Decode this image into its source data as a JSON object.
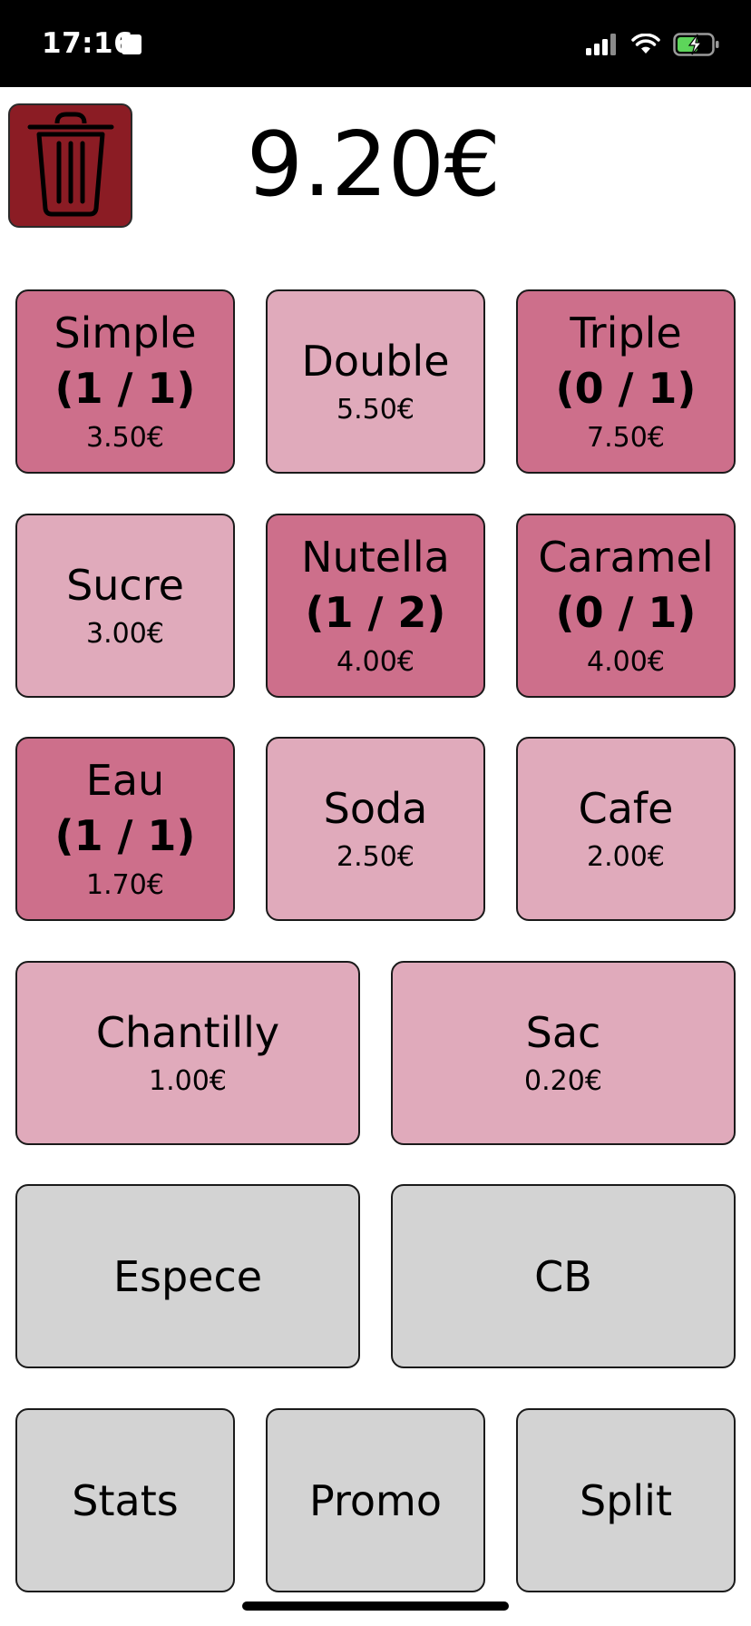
{
  "status_bar": {
    "time": "17:16"
  },
  "header": {
    "total": "9.20€",
    "trash_icon": "trash-icon",
    "trash_color": "#8b1c24"
  },
  "colors": {
    "tile_light": "#e0aabb",
    "tile_dark": "#cd6f8b",
    "tile_gray": "#d3d3d3"
  },
  "products": [
    {
      "name": "Simple",
      "count": "(1 / 1)",
      "price": "3.50€"
    },
    {
      "name": "Double",
      "count": "",
      "price": "5.50€"
    },
    {
      "name": "Triple",
      "count": "(0 / 1)",
      "price": "7.50€"
    },
    {
      "name": "Sucre",
      "count": "",
      "price": "3.00€"
    },
    {
      "name": "Nutella",
      "count": "(1 / 2)",
      "price": "4.00€"
    },
    {
      "name": "Caramel",
      "count": "(0 / 1)",
      "price": "4.00€"
    },
    {
      "name": "Eau",
      "count": "(1 / 1)",
      "price": "1.70€"
    },
    {
      "name": "Soda",
      "count": "",
      "price": "2.50€"
    },
    {
      "name": "Cafe",
      "count": "",
      "price": "2.00€"
    },
    {
      "name": "Chantilly",
      "count": "",
      "price": "1.00€"
    },
    {
      "name": "Sac",
      "count": "",
      "price": "0.20€"
    }
  ],
  "payment": {
    "cash_label": "Espece",
    "card_label": "CB"
  },
  "actions": {
    "stats_label": "Stats",
    "promo_label": "Promo",
    "split_label": "Split"
  }
}
